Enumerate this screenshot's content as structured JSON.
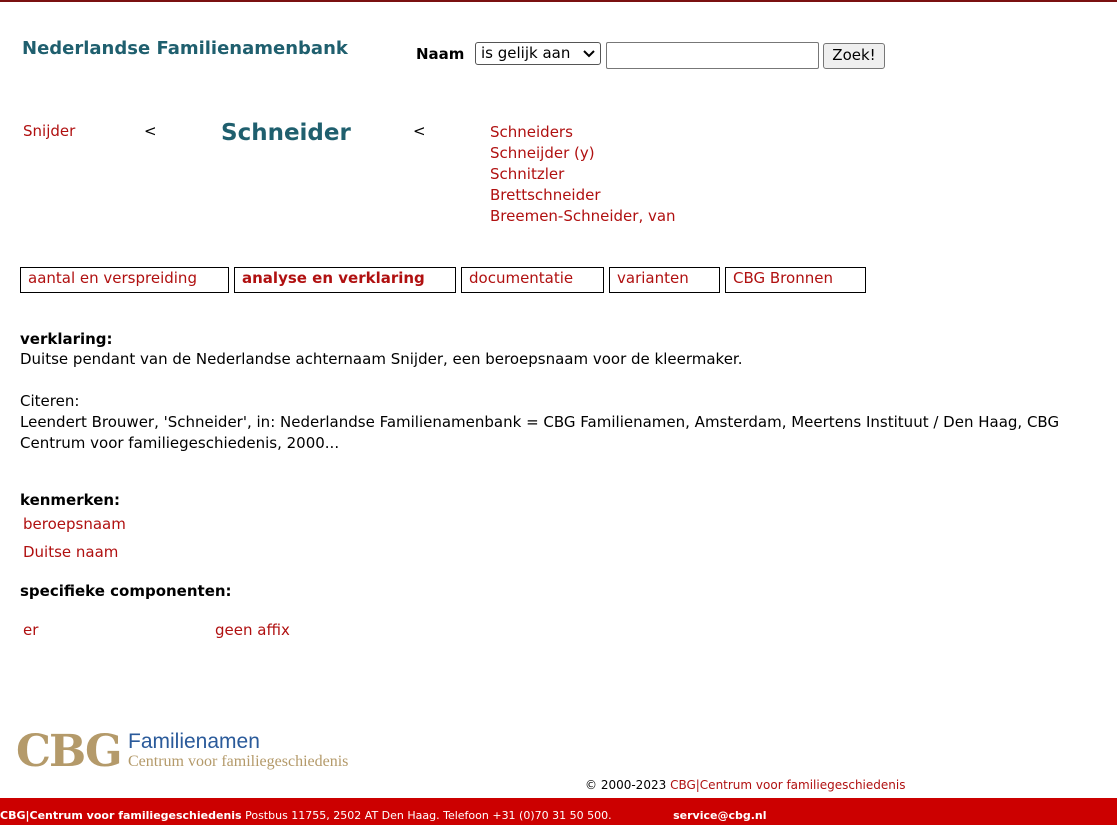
{
  "header": {
    "site_title": "Nederlandse Familienamenbank",
    "search": {
      "label": "Naam",
      "operator_selected": "is gelijk aan",
      "input_value": "",
      "button_label": "Zoek!"
    }
  },
  "relations": {
    "left_name": "Snijder",
    "left_arrow": "<",
    "main_name": "Schneider",
    "right_arrow": "<",
    "variants": [
      "Schneiders",
      "Schneijder (y)",
      "Schnitzler",
      "Brettschneider",
      "Breemen-Schneider, van"
    ]
  },
  "tabs": [
    {
      "label": "aantal en verspreiding",
      "active": false
    },
    {
      "label": "analyse en verklaring",
      "active": true
    },
    {
      "label": "documentatie",
      "active": false
    },
    {
      "label": "varianten",
      "active": false
    },
    {
      "label": "CBG Bronnen",
      "active": false
    }
  ],
  "content": {
    "verklaring_label": "verklaring:",
    "verklaring_text": "Duitse pendant van de Nederlandse achternaam Snijder, een beroepsnaam voor de kleermaker.",
    "citeren_label": "Citeren:",
    "citeren_text_line1": "Leendert Brouwer, 'Schneider', in: Nederlandse Familienamenbank = CBG Familienamen, Amsterdam, Meertens Instituut / Den Haag, CBG",
    "citeren_text_line2": "Centrum voor familiegeschiedenis, 2000...",
    "kenmerken_label": "kenmerken:",
    "kenmerken": [
      "beroepsnaam",
      "Duitse naam"
    ],
    "componenten_label": "specifieke componenten:",
    "componenten": [
      "er",
      "geen affix"
    ]
  },
  "logo": {
    "letters": "CBG",
    "title": "Familienamen",
    "subtitle": "Centrum voor familiegeschiedenis",
    "colors": {
      "letters": "#b49a6a",
      "title": "#2a5a9a",
      "subtitle": "#b49a6a"
    }
  },
  "footer": {
    "copyright_prefix": "© 2000-2023",
    "copyright_link": "CBG|Centrum voor familiegeschiedenis",
    "bar_org": "CBG|Centrum voor familiegeschiedenis",
    "bar_address": "Postbus 11755, 2502 AT Den Haag. Telefoon +31 (0)70 31 50 500.",
    "bar_email": "service@cbg.nl"
  },
  "colors": {
    "link": "#b01010",
    "title": "#1f5f6e",
    "footer_bar": "#cc0000",
    "top_border": "#7a1010"
  }
}
